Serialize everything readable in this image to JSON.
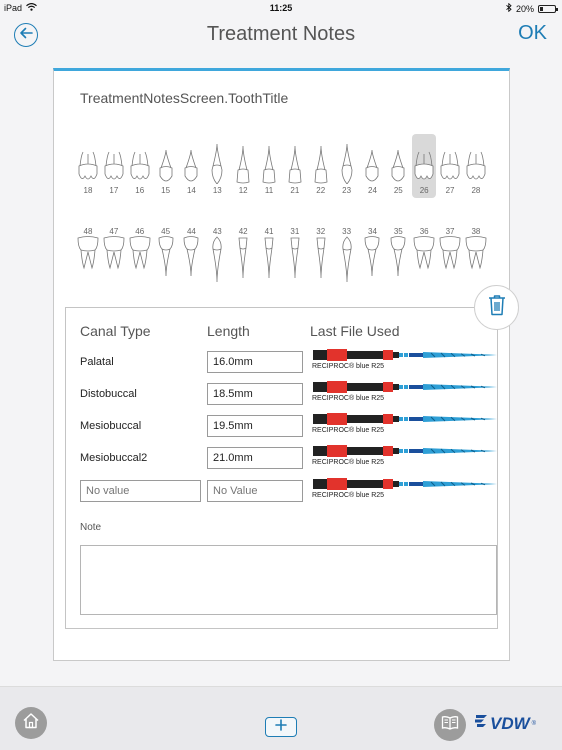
{
  "status": {
    "device": "iPad",
    "time": "11:25",
    "battery": "20%",
    "battery_level": 0.2
  },
  "nav": {
    "title": "Treatment Notes",
    "ok": "OK"
  },
  "card": {
    "tooth_title": "TreatmentNotesScreen.ToothTitle",
    "upper_teeth": [
      "18",
      "17",
      "16",
      "15",
      "14",
      "13",
      "12",
      "11",
      "21",
      "22",
      "23",
      "24",
      "25",
      "26",
      "27",
      "28"
    ],
    "lower_teeth": [
      "48",
      "47",
      "46",
      "45",
      "44",
      "43",
      "42",
      "41",
      "31",
      "32",
      "33",
      "34",
      "35",
      "36",
      "37",
      "38"
    ],
    "selected_tooth": "26"
  },
  "table": {
    "headers": {
      "canal_type": "Canal Type",
      "length": "Length",
      "last_file": "Last File Used"
    },
    "rows": [
      {
        "canal": "Palatal",
        "length": "16.0mm",
        "file": "RECIPROC® blue R25"
      },
      {
        "canal": "Distobuccal",
        "length": "18.5mm",
        "file": "RECIPROC® blue R25"
      },
      {
        "canal": "Mesiobuccal",
        "length": "19.5mm",
        "file": "RECIPROC® blue R25"
      },
      {
        "canal": "Mesiobuccal2",
        "length": "21.0mm",
        "file": "RECIPROC® blue R25"
      }
    ],
    "new_row": {
      "canal_placeholder": "No value",
      "length_placeholder": "No Value",
      "file": "RECIPROC® blue R25"
    },
    "note_label": "Note",
    "note_value": ""
  },
  "bottom": {
    "logo": "VDW",
    "logo_mark": "®"
  },
  "colors": {
    "accent": "#1e7db5",
    "card_top": "#3fa7dc",
    "file_red": "#e2332c",
    "file_blue": "#2e9fd6"
  }
}
